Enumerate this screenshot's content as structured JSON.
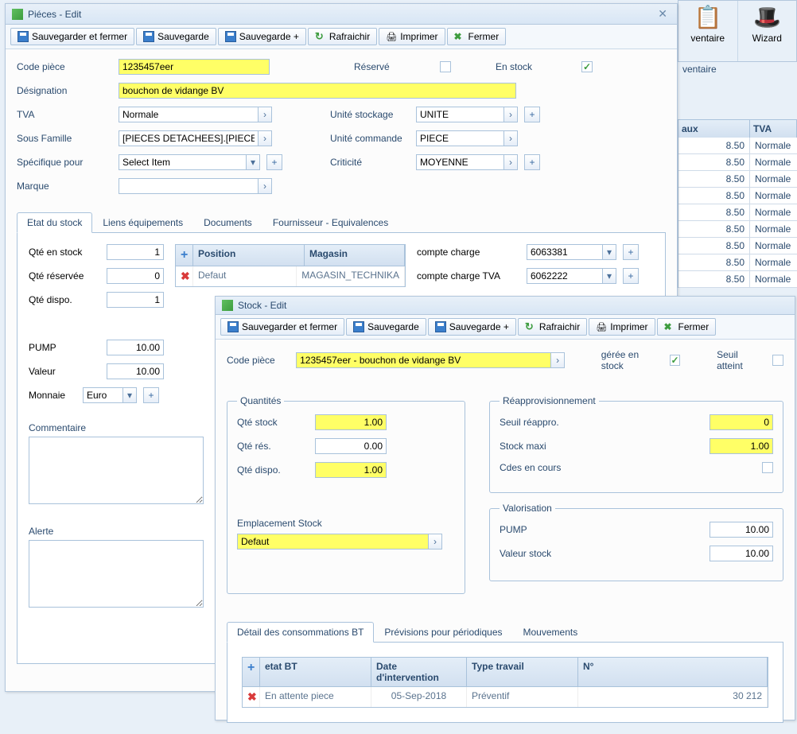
{
  "background": {
    "buttons": [
      {
        "icon": "clip",
        "label": "ventaire"
      },
      {
        "icon": "wiz",
        "label": "Wizard"
      }
    ],
    "tab_partial": "ventaire",
    "grid_headers": [
      "aux",
      "TVA"
    ],
    "grid_rows": [
      {
        "aux": "8.50",
        "tva": "Normale"
      },
      {
        "aux": "8.50",
        "tva": "Normale"
      },
      {
        "aux": "8.50",
        "tva": "Normale"
      },
      {
        "aux": "8.50",
        "tva": "Normale"
      },
      {
        "aux": "8.50",
        "tva": "Normale"
      },
      {
        "aux": "8.50",
        "tva": "Normale"
      },
      {
        "aux": "8.50",
        "tva": "Normale"
      },
      {
        "aux": "8.50",
        "tva": "Normale"
      },
      {
        "aux": "8.50",
        "tva": "Normale"
      }
    ]
  },
  "pieces_window": {
    "title": "Piéces - Edit",
    "toolbar": {
      "save_close": "Sauvegarder et fermer",
      "save": "Sauvegarde",
      "save_plus": "Sauvegarde +",
      "refresh": "Rafraichir",
      "print": "Imprimer",
      "close": "Fermer"
    },
    "labels": {
      "code": "Code pièce",
      "designation": "Désignation",
      "tva": "TVA",
      "sous_famille": "Sous Famille",
      "spec_pour": "Spécifique pour",
      "marque": "Marque",
      "unite_stock": "Unité stockage",
      "unite_cmd": "Unité commande",
      "criticite": "Criticité",
      "reserve": "Réservé",
      "en_stock": "En stock"
    },
    "values": {
      "code": "1235457eer",
      "designation": "bouchon de vidange BV",
      "tva": "Normale",
      "sous_famille": "[PIECES DETACHEES].[PIECE MECANIQ",
      "spec_pour": "Select Item",
      "marque": "",
      "unite_stock": "UNITE",
      "unite_cmd": "PIECE",
      "criticite": "MOYENNE",
      "reserve": false,
      "en_stock": true
    },
    "tabs": [
      "Etat du stock",
      "Liens équipements",
      "Documents",
      "Fournisseur - Equivalences"
    ],
    "stock_fields": {
      "qte_stock": {
        "label": "Qté en stock",
        "val": "1"
      },
      "qte_res": {
        "label": "Qté réservée",
        "val": "0"
      },
      "qte_dispo": {
        "label": "Qté dispo.",
        "val": "1"
      },
      "pump": {
        "label": "PUMP",
        "val": "10.00"
      },
      "valeur": {
        "label": "Valeur",
        "val": "10.00"
      },
      "monnaie": {
        "label": "Monnaie",
        "val": "Euro"
      },
      "comment": {
        "label": "Commentaire"
      },
      "alerte": {
        "label": "Alerte"
      }
    },
    "pos_grid": {
      "headers": [
        "Position",
        "Magasin"
      ],
      "row": {
        "pos": "Defaut",
        "mag": "MAGASIN_TECHNIKA"
      }
    },
    "compte": {
      "charge_lbl": "compte charge",
      "charge": "6063381",
      "tva_lbl": "compte charge TVA",
      "tva": "6062222"
    }
  },
  "stock_window": {
    "title": "Stock - Edit",
    "toolbar": {
      "save_close": "Sauvegarder et fermer",
      "save": "Sauvegarde",
      "save_plus": "Sauvegarde +",
      "refresh": "Rafraichir",
      "print": "Imprimer",
      "close": "Fermer"
    },
    "labels": {
      "code": "Code pièce",
      "geree": "gérée en stock",
      "seuil_att": "Seuil atteint"
    },
    "values": {
      "code": "1235457eer - bouchon de vidange BV",
      "geree": true,
      "seuil_att": false
    },
    "quantites": {
      "legend": "Quantités",
      "stock": {
        "label": "Qté stock",
        "val": "1.00"
      },
      "res": {
        "label": "Qté rés.",
        "val": "0.00"
      },
      "dispo": {
        "label": "Qté dispo.",
        "val": "1.00"
      }
    },
    "emplacement": {
      "label": "Emplacement Stock",
      "val": "Defaut"
    },
    "reappro": {
      "legend": "Réapprovisionnement",
      "seuil": {
        "label": "Seuil réappro.",
        "val": "0"
      },
      "maxi": {
        "label": "Stock maxi",
        "val": "1.00"
      },
      "cdes": {
        "label": "Cdes en cours",
        "val": false
      }
    },
    "valo": {
      "legend": "Valorisation",
      "pump": {
        "label": "PUMP",
        "val": "10.00"
      },
      "valeur": {
        "label": "Valeur stock",
        "val": "10.00"
      }
    },
    "tabs": [
      "Détail des consommations BT",
      "Prévisions pour périodiques",
      "Mouvements"
    ],
    "bt_grid": {
      "headers": [
        "etat BT",
        "Date d'intervention",
        "Type travail",
        "N°"
      ],
      "row": {
        "etat": "En attente piece",
        "date": "05-Sep-2018",
        "type": "Préventif",
        "num": "30 212"
      }
    }
  }
}
